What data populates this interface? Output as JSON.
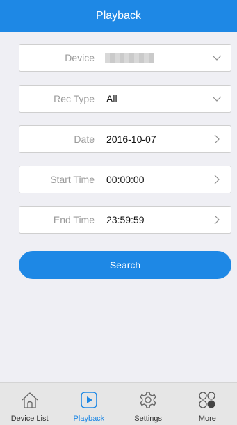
{
  "header": {
    "title": "Playback"
  },
  "form": {
    "device": {
      "label": "Device",
      "value": ""
    },
    "rec_type": {
      "label": "Rec Type",
      "value": "All"
    },
    "date": {
      "label": "Date",
      "value": "2016-10-07"
    },
    "start_time": {
      "label": "Start Time",
      "value": "00:00:00"
    },
    "end_time": {
      "label": "End Time",
      "value": "23:59:59"
    }
  },
  "search": {
    "label": "Search"
  },
  "tabbar": {
    "active": "Playback",
    "tabs": [
      {
        "label": "Device List",
        "icon": "home-icon"
      },
      {
        "label": "Playback",
        "icon": "play-icon"
      },
      {
        "label": "Settings",
        "icon": "gear-icon"
      },
      {
        "label": "More",
        "icon": "more-icon"
      }
    ]
  },
  "colors": {
    "accent": "#1e88e5",
    "background": "#efeff4",
    "tabbar": "#e6e6e6",
    "label": "#9a9a9a"
  }
}
